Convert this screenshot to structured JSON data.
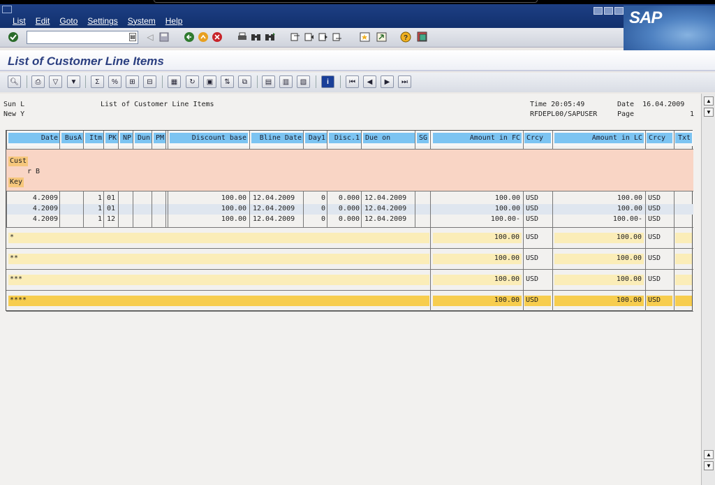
{
  "menu": {
    "items": [
      "List",
      "Edit",
      "Goto",
      "Settings",
      "System",
      "Help"
    ]
  },
  "brand": {
    "logo": "SAP"
  },
  "command_field": {
    "value": ""
  },
  "title": "List of Customer Line Items",
  "list_header": {
    "left1": "Sun L",
    "left2": "New Y",
    "center": "List of Customer Line Items",
    "time_label": "Time 20:05:49",
    "date_label": "Date  16.04.2009",
    "program": "RFDEPL00/SAPUSER",
    "page_label": "Page",
    "page_num": "1"
  },
  "table": {
    "headers": [
      "Date",
      "BusA",
      "Itm",
      "PK",
      "NP",
      "Dun",
      "PM",
      "Discount base",
      "Bline Date",
      "Day1",
      "Disc.1",
      "Due on",
      "SG",
      "Amount in FC",
      "Crcy",
      "Amount in LC",
      "Crcy",
      "Txt"
    ],
    "group": {
      "cust_label": "Cust",
      "name": "r B",
      "key_label": "Key"
    },
    "rows": [
      [
        "4.2009",
        "",
        "1",
        "01",
        "",
        "",
        "",
        "100.00",
        "12.04.2009",
        "0",
        "0.000",
        "12.04.2009",
        "",
        "100.00",
        "USD",
        "100.00",
        "USD",
        ""
      ],
      [
        "4.2009",
        "",
        "1",
        "01",
        "",
        "",
        "",
        "100.00",
        "12.04.2009",
        "0",
        "0.000",
        "12.04.2009",
        "",
        "100.00",
        "USD",
        "100.00",
        "USD",
        ""
      ],
      [
        "4.2009",
        "",
        "1",
        "12",
        "",
        "",
        "",
        "100.00",
        "12.04.2009",
        "0",
        "0.000",
        "12.04.2009",
        "",
        "100.00-",
        "USD",
        "100.00-",
        "USD",
        ""
      ]
    ],
    "totals": [
      {
        "marker": "*",
        "fc": "100.00",
        "fc_cur": "USD",
        "lc": "100.00",
        "lc_cur": "USD"
      },
      {
        "marker": "**",
        "fc": "100.00",
        "fc_cur": "USD",
        "lc": "100.00",
        "lc_cur": "USD"
      },
      {
        "marker": "***",
        "fc": "100.00",
        "fc_cur": "USD",
        "lc": "100.00",
        "lc_cur": "USD"
      },
      {
        "marker": "****",
        "fc": "100.00",
        "fc_cur": "USD",
        "lc": "100.00",
        "lc_cur": "USD"
      }
    ]
  },
  "colors": {
    "menubar": "#1d3f84",
    "header_cell": "#7cc4f2",
    "group_bg": "#f9d5c5",
    "group_label": "#f6c77c",
    "total_light": "#fbedb8",
    "total_dark": "#f7cd4e",
    "row_alt": "#dfe6ef"
  },
  "icons": {
    "std_toolbar": [
      "enter-check-icon",
      "save-icon",
      "back-icon",
      "exit-icon",
      "cancel-icon",
      "print-icon",
      "find-icon",
      "find-next-icon",
      "first-page-icon",
      "prev-page-icon",
      "next-page-icon",
      "last-page-icon",
      "new-session-icon",
      "shortcut-icon",
      "help-icon",
      "customize-layout-icon"
    ],
    "app_toolbar": [
      "detail-icon",
      "print-list-icon",
      "filter-set-icon",
      "filter-icon",
      "sum-icon",
      "subtotal-icon",
      "expand-icon",
      "collapse-icon",
      "choose-layout-icon",
      "change-layout-icon",
      "save-layout-icon",
      "sort-icon",
      "export-icon",
      "column-icon",
      "select-column-icon",
      "deselect-column-icon",
      "info-icon",
      "first-icon",
      "prev-icon",
      "next-icon",
      "last-icon"
    ]
  }
}
